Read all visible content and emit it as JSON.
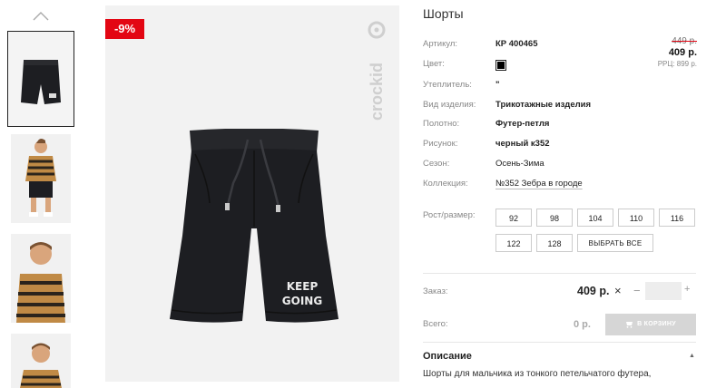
{
  "product": {
    "title": "Шорты",
    "discount_badge": "-9%",
    "brand": "crockid"
  },
  "properties": [
    {
      "label": "Артикул:",
      "value": "КР 400465"
    },
    {
      "label": "Цвет:",
      "value": ""
    },
    {
      "label": "Утеплитель:",
      "value": "\""
    },
    {
      "label": "Вид изделия:",
      "value": "Трикотажные изделия"
    },
    {
      "label": "Полотно:",
      "value": "Футер-петля"
    },
    {
      "label": "Рисунок:",
      "value": "черный к352"
    },
    {
      "label": "Сезон:",
      "value": "Осень-Зима"
    },
    {
      "label": "Коллекция:",
      "value": "№352 Зебра в городе"
    }
  ],
  "color_swatch": "#000000",
  "price": {
    "old": "449 р.",
    "new": "409 р.",
    "rrp": "РРЦ: 899 р."
  },
  "sizes": {
    "label": "Рост/размер:",
    "options": [
      "92",
      "98",
      "104",
      "110",
      "116",
      "122",
      "128"
    ],
    "select_all": "ВЫБРАТЬ ВСЕ"
  },
  "order": {
    "label": "Заказ:",
    "price": "409 р.",
    "quantity": "",
    "total_label": "Всего:",
    "total": "0 р.",
    "cart_button": "В КОРЗИНУ"
  },
  "description": {
    "title": "Описание",
    "text": "Шорты для мальчика из тонкого петельчатого футера,"
  },
  "shorts_print": {
    "line1": "KEEP",
    "line2": "GOING"
  },
  "colors": {
    "accent": "#e30613",
    "shorts": "#1d1e22",
    "background": "#f2f2f2"
  }
}
